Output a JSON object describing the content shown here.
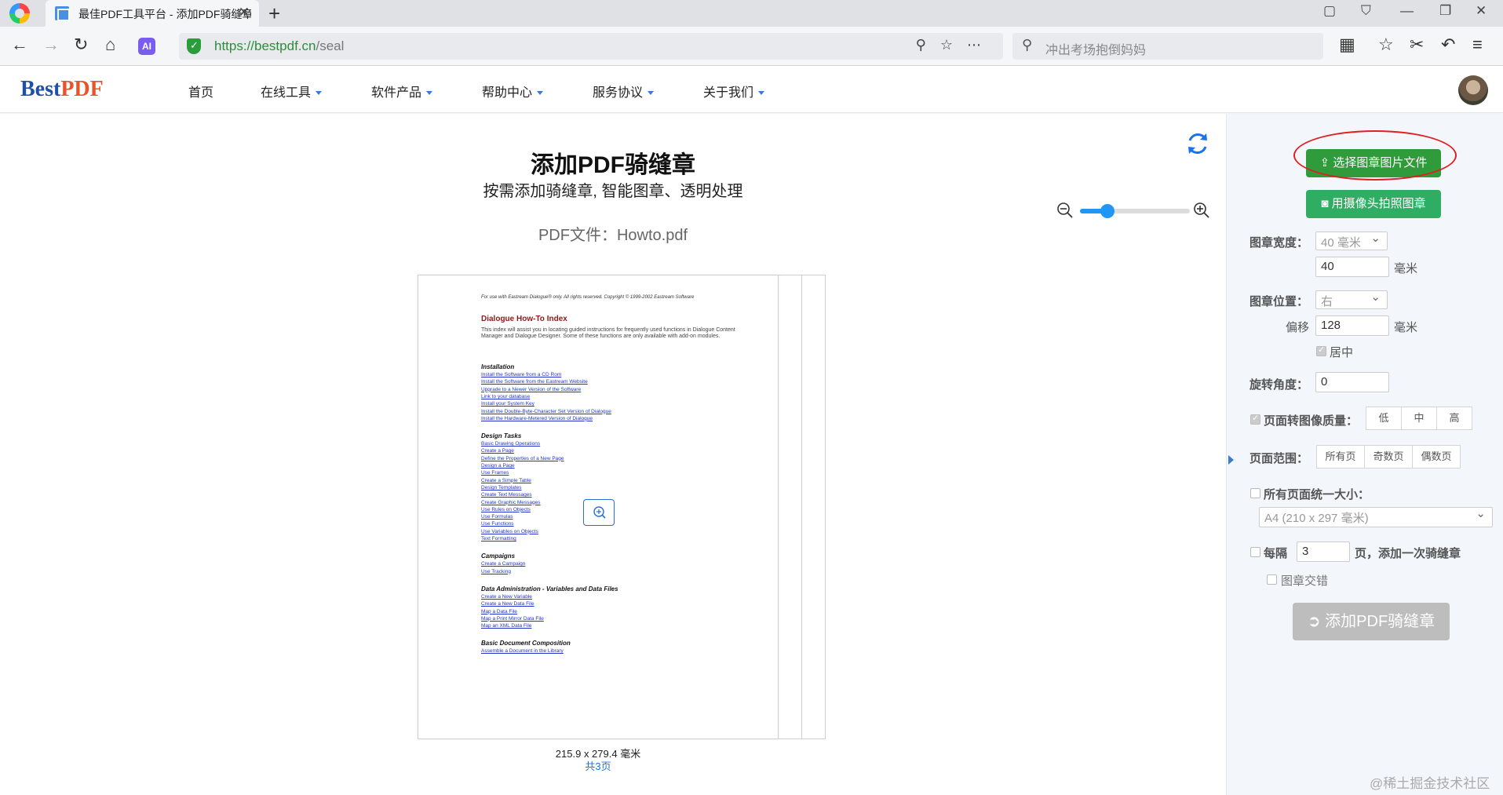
{
  "browser": {
    "tab_title": "最佳PDF工具平台 - 添加PDF骑缝章",
    "url_host": "https://bestpdf.cn",
    "url_path": "/seal",
    "search_placeholder": "冲出考场抱倒妈妈"
  },
  "header": {
    "logo_best": "Best",
    "logo_pdf": "PDF",
    "nav": [
      {
        "label": "首页"
      },
      {
        "label": "在线工具"
      },
      {
        "label": "软件产品"
      },
      {
        "label": "帮助中心"
      },
      {
        "label": "服务协议"
      },
      {
        "label": "关于我们"
      }
    ]
  },
  "main": {
    "title": "添加PDF骑缝章",
    "subtitle": "按需添加骑缝章, 智能图章、透明处理",
    "file_label": "PDF文件：Howto.pdf",
    "zoom_level": 0.25,
    "page_size": "215.9 x 279.4 毫米",
    "page_count": "共3页"
  },
  "document": {
    "header_line": "For use with Eastream Dialogue® only. All rights reserved. Copyright © 1999-2002 Eastream Software",
    "title": "Dialogue How-To Index",
    "intro": "This index will assist you in locating guided instructions for frequently used functions in Dialogue Content Manager and Dialogue Designer. Some of these functions are only available with add-on modules.",
    "sections": [
      {
        "heading": "Installation",
        "links": [
          "Install the Software from a CD Rom",
          "Install the Software from the Eastream Website",
          "Upgrade to a Newer Version of the Software",
          "Link to your database",
          "Install your System Key",
          "Install the Double-Byte-Character Set Version of Dialogue",
          "Install the Hardware-Metered Version of Dialogue"
        ]
      },
      {
        "heading": "Design Tasks",
        "links": [
          "Basic Drawing Operations",
          "Create a Page",
          "Define the Properties of a New Page",
          "Design a Page",
          "Use Frames",
          "Create a Simple Table",
          "Design Templates",
          "Create Text Messages",
          "Create Graphic Messages",
          "Use Rules on Objects",
          "Use Formulas",
          "Use Functions",
          "Use Variables on Objects",
          "Text Formatting"
        ]
      },
      {
        "heading": "Campaigns",
        "links": [
          "Create a Campaign",
          "Use Tracking"
        ]
      },
      {
        "heading": "Data Administration - Variables and Data Files",
        "links": [
          "Create a New Variable",
          "Create a New Data File",
          "Map a Data File",
          "Map a Print Mirror Data File",
          "Map an XML Data File"
        ]
      },
      {
        "heading": "Basic Document Composition",
        "links": [
          "Assemble a Document in the Library"
        ]
      }
    ]
  },
  "panel": {
    "btn_select_image": "选择图章图片文件",
    "btn_camera": "用摄像头拍照图章",
    "width_label": "图章宽度：",
    "width_select": "40 毫米",
    "width_value": "40",
    "unit_mm": "毫米",
    "position_label": "图章位置：",
    "position_select": "右",
    "offset_label": "偏移",
    "offset_value": "128",
    "center_label": "居中",
    "rotate_label": "旋转角度：",
    "rotate_value": "0",
    "quality_label": "页面转图像质量：",
    "quality_options": [
      "低",
      "中",
      "高"
    ],
    "range_label": "页面范围：",
    "range_options": [
      "所有页",
      "奇数页",
      "偶数页"
    ],
    "uniform_label": "所有页面统一大小：",
    "uniform_select": "A4 (210 x 297 毫米)",
    "every_label": "每隔",
    "every_value": "3",
    "every_suffix": "页，添加一次骑缝章",
    "stagger_label": "图章交错",
    "submit_label": "添加PDF骑缝章"
  },
  "watermark": "@稀土掘金技术社区",
  "colors": {
    "accent": "#2f9b3a",
    "link": "#1a73e8",
    "highlight_ellipse": "#e02020"
  }
}
